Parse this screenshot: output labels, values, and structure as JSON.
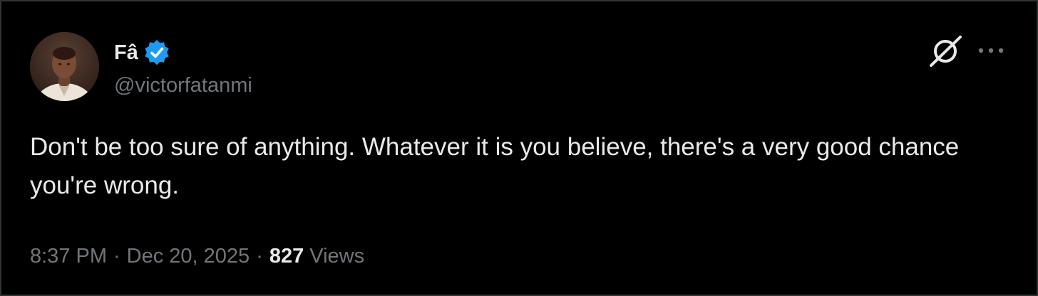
{
  "author": {
    "display_name": "Fâ",
    "handle": "@victorfatanmi",
    "verified": true,
    "verified_badge_color": "#1d9bf0"
  },
  "header_actions": {
    "grok_icon": "grok-icon",
    "more_icon": "more-horizontal-icon"
  },
  "tweet": {
    "text": "Don't be too sure of anything. Whatever it is you believe, there's a very good chance you're wrong."
  },
  "meta": {
    "time": "8:37 PM",
    "separator": "·",
    "date": "Dec 20, 2025",
    "views_count": "827",
    "views_label": "Views"
  },
  "colors": {
    "background": "#000000",
    "primary_text": "#e7e9ea",
    "secondary_text": "#71767b",
    "accent": "#1d9bf0"
  }
}
